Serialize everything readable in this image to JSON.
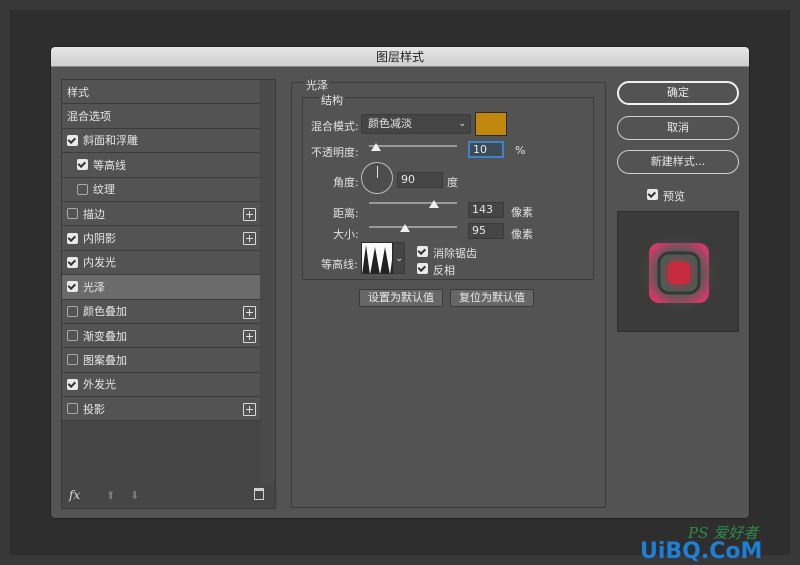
{
  "dialog": {
    "title": "图层样式"
  },
  "styles_list": {
    "items": [
      {
        "label": "样式",
        "checkbox": null,
        "checked": false,
        "indent": 0,
        "plus": false,
        "selected": false,
        "header": true
      },
      {
        "label": "混合选项",
        "checkbox": null,
        "checked": false,
        "indent": 0,
        "plus": false,
        "selected": false,
        "header": true
      },
      {
        "label": "斜面和浮雕",
        "checkbox": true,
        "checked": true,
        "indent": 0,
        "plus": false,
        "selected": false
      },
      {
        "label": "等高线",
        "checkbox": true,
        "checked": true,
        "indent": 1,
        "plus": false,
        "selected": false
      },
      {
        "label": "纹理",
        "checkbox": true,
        "checked": false,
        "indent": 1,
        "plus": false,
        "selected": false
      },
      {
        "label": "描边",
        "checkbox": true,
        "checked": false,
        "indent": 0,
        "plus": true,
        "selected": false
      },
      {
        "label": "内阴影",
        "checkbox": true,
        "checked": true,
        "indent": 0,
        "plus": true,
        "selected": false
      },
      {
        "label": "内发光",
        "checkbox": true,
        "checked": true,
        "indent": 0,
        "plus": false,
        "selected": false
      },
      {
        "label": "光泽",
        "checkbox": true,
        "checked": true,
        "indent": 0,
        "plus": false,
        "selected": true
      },
      {
        "label": "颜色叠加",
        "checkbox": true,
        "checked": false,
        "indent": 0,
        "plus": true,
        "selected": false
      },
      {
        "label": "渐变叠加",
        "checkbox": true,
        "checked": false,
        "indent": 0,
        "plus": true,
        "selected": false
      },
      {
        "label": "图案叠加",
        "checkbox": true,
        "checked": false,
        "indent": 0,
        "plus": false,
        "selected": false
      },
      {
        "label": "外发光",
        "checkbox": true,
        "checked": true,
        "indent": 0,
        "plus": false,
        "selected": false
      },
      {
        "label": "投影",
        "checkbox": true,
        "checked": false,
        "indent": 0,
        "plus": true,
        "selected": false
      }
    ],
    "fx_label": "fx"
  },
  "satin": {
    "section_title": "光泽",
    "group_title": "结构",
    "blend_mode_label": "混合模式:",
    "blend_mode_value": "颜色减淡",
    "color": "#c1860e",
    "opacity_label": "不透明度:",
    "opacity_value": "10",
    "opacity_unit": "%",
    "angle_label": "角度:",
    "angle_value": "90",
    "angle_unit": "度",
    "distance_label": "距离:",
    "distance_value": "143",
    "distance_unit": "像素",
    "size_label": "大小:",
    "size_value": "95",
    "size_unit": "像素",
    "contour_label": "等高线:",
    "anti_alias_label": "消除锯齿",
    "anti_alias_checked": true,
    "invert_label": "反相",
    "invert_checked": true,
    "set_default_label": "设置为默认值",
    "reset_default_label": "复位为默认值"
  },
  "actions": {
    "ok_label": "确定",
    "cancel_label": "取消",
    "new_style_label": "新建样式...",
    "preview_label": "预览",
    "preview_checked": true
  },
  "watermark": {
    "text_top": "PS 爱好者",
    "text_bottom": "UiBQ.CoM"
  }
}
